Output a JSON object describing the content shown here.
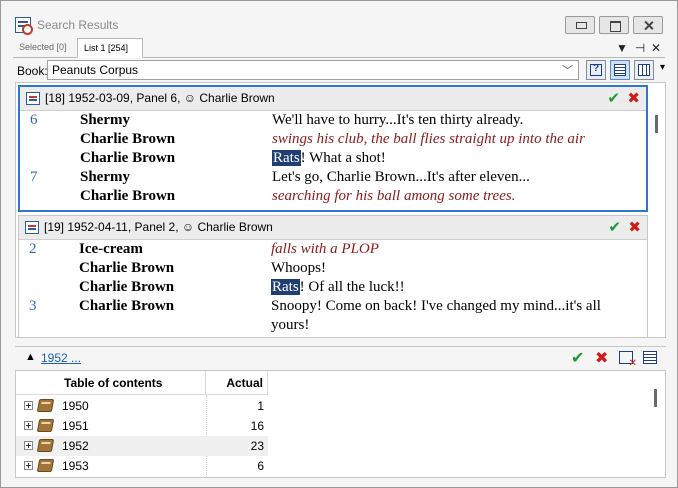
{
  "window": {
    "title": "Search Results"
  },
  "tabs": [
    {
      "label": "Selected [0]",
      "active": false
    },
    {
      "label": "List 1 [254]",
      "active": true
    }
  ],
  "tab_tools": {
    "dropdown_icon": "triangle-down-icon",
    "pin_icon": "pin-icon",
    "close_icon": "close-icon"
  },
  "book": {
    "label": "Book:",
    "value": "Peanuts Corpus"
  },
  "results": [
    {
      "header": "[18] 1952-03-09, Panel 6, ☺ Charlie Brown",
      "lines": [
        {
          "num": "6",
          "speaker": "Shermy",
          "text": "We'll have to hurry...It's ten thirty already.",
          "stage": false
        },
        {
          "num": "",
          "speaker": "Charlie Brown",
          "text": "swings his club, the ball flies straight up into the air",
          "stage": true
        },
        {
          "num": "",
          "speaker": "Charlie Brown",
          "hl": "Rats",
          "text": "! What a shot!",
          "stage": false
        },
        {
          "num": "7",
          "speaker": "Shermy",
          "text": "Let's go, Charlie Brown...It's after eleven...",
          "stage": false
        },
        {
          "num": "",
          "speaker": "Charlie Brown",
          "text": "searching for his ball among some trees.",
          "stage": true
        }
      ]
    },
    {
      "header": "[19] 1952-04-11, Panel 2, ☺ Charlie Brown",
      "lines": [
        {
          "num": "2",
          "speaker": "Ice-cream",
          "text": "falls with a PLOP",
          "stage": true
        },
        {
          "num": "",
          "speaker": "Charlie Brown",
          "text": "Whoops!",
          "stage": false
        },
        {
          "num": "",
          "speaker": "Charlie Brown",
          "hl": "Rats",
          "text": "! Of all the luck!!",
          "stage": false
        },
        {
          "num": "3",
          "speaker": "Charlie Brown",
          "text": "Snoopy! Come on back! I've changed my mind...it's all",
          "stage": false
        },
        {
          "num": "",
          "speaker": "",
          "text": "yours!",
          "stage": false
        }
      ]
    }
  ],
  "toc_panel": {
    "link": "1952 ...",
    "headers": {
      "name": "Table of contents",
      "actual": "Actual"
    },
    "rows": [
      {
        "label": "1950",
        "count": "1"
      },
      {
        "label": "1951",
        "count": "16"
      },
      {
        "label": "1952",
        "count": "23",
        "selected": true
      },
      {
        "label": "1953",
        "count": "6"
      }
    ]
  },
  "colors": {
    "accent": "#2f77c8",
    "ok": "#1e9a2a",
    "delete": "#d01c1c",
    "stage_text": "#8b1a1a",
    "highlight": "#1f3f73"
  }
}
